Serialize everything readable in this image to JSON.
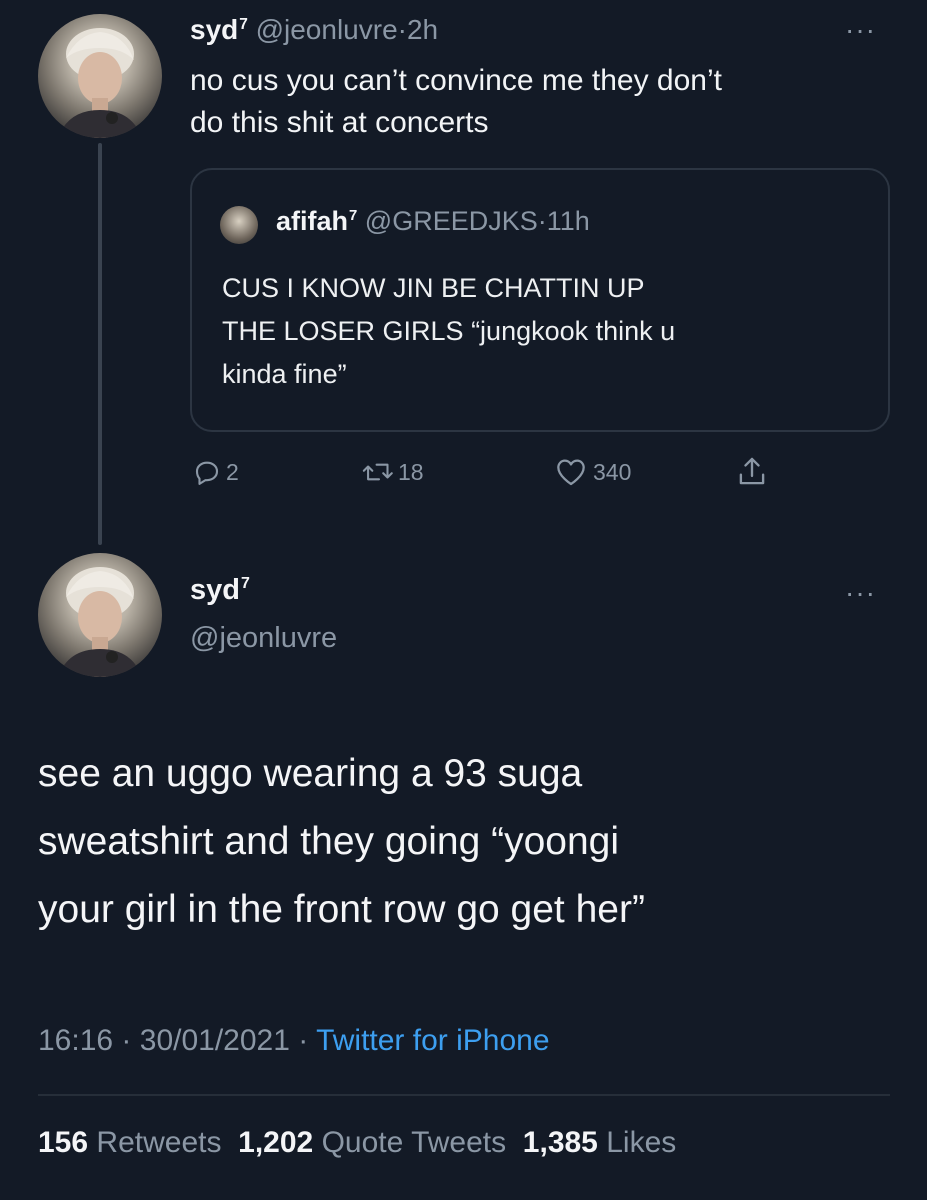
{
  "tweet1": {
    "display_name": "syd",
    "name_sup": "7",
    "handle": "@jeonluvre",
    "separator": "·",
    "time": "2h",
    "more": "···",
    "text_line1": "no cus you can’t convince me they don’t",
    "text_line2": "do this shit at concerts",
    "quote": {
      "display_name": "afifah",
      "name_sup": "7",
      "handle": "@GREEDJKS",
      "separator": "·",
      "time": "11h",
      "line1": "CUS I KNOW JIN BE CHATTIN UP",
      "line2": "THE LOSER GIRLS “jungkook think u",
      "line3": "kinda fine”"
    },
    "actions": {
      "replies": "2",
      "retweets": "18",
      "likes": "340"
    }
  },
  "tweet2": {
    "display_name": "syd",
    "name_sup": "7",
    "handle": "@jeonluvre",
    "more": "···",
    "line1": "see an uggo wearing a 93 suga",
    "line2": "sweatshirt and they going “yoongi",
    "line3": "your girl in the front row go get her”",
    "time": "16:16",
    "sep1": "·",
    "date": "30/01/2021",
    "sep2": "·",
    "source": "Twitter for iPhone",
    "stats": {
      "retweets_count": "156",
      "retweets_label": "Retweets",
      "quotes_count": "1,202",
      "quotes_label": "Quote Tweets",
      "likes_count": "1,385",
      "likes_label": "Likes"
    }
  },
  "icons": {
    "reply": "reply-icon",
    "retweet": "retweet-icon",
    "like": "heart-icon",
    "share": "share-icon",
    "more": "more-icon"
  },
  "colors": {
    "background": "#131a26",
    "text": "#f4f5f7",
    "muted": "#8b97a5",
    "link": "#3d9ff0",
    "border": "#2c3542"
  }
}
